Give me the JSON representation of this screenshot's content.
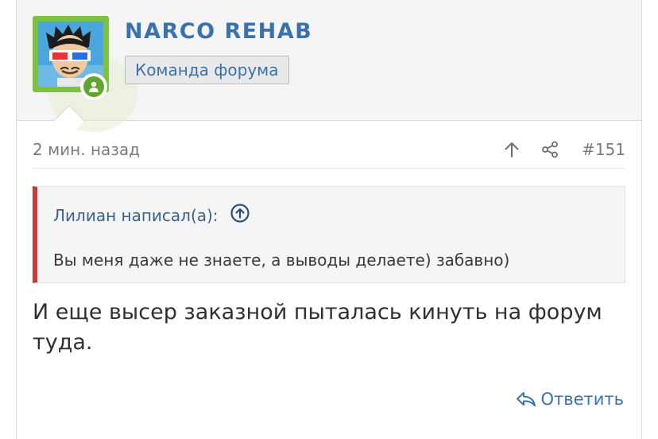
{
  "user": {
    "name": "NARCO REHAB",
    "title_badge": "Команда форума",
    "avatar_icon": "avatar-3d-glasses-icon",
    "online_icon": "user-online-icon"
  },
  "post": {
    "time": "2 мин. назад",
    "number": "#151",
    "actions": {
      "up_icon": "arrow-up-icon",
      "share_icon": "share-icon"
    },
    "quote": {
      "author": "Лилиан написал(а):",
      "goto_icon": "circle-arrow-up-icon",
      "text": "Вы меня даже не знаете, а выводы делаете) забавно)"
    },
    "body": "И еще высер заказной пыталась кинуть на форум туда.",
    "reply_label": "Ответить",
    "reply_icon": "reply-icon"
  },
  "colors": {
    "link": "#3a72ad",
    "quote_bar": "#cc3a32",
    "avatar_frame": "#7fc041",
    "online": "#5fa530"
  }
}
